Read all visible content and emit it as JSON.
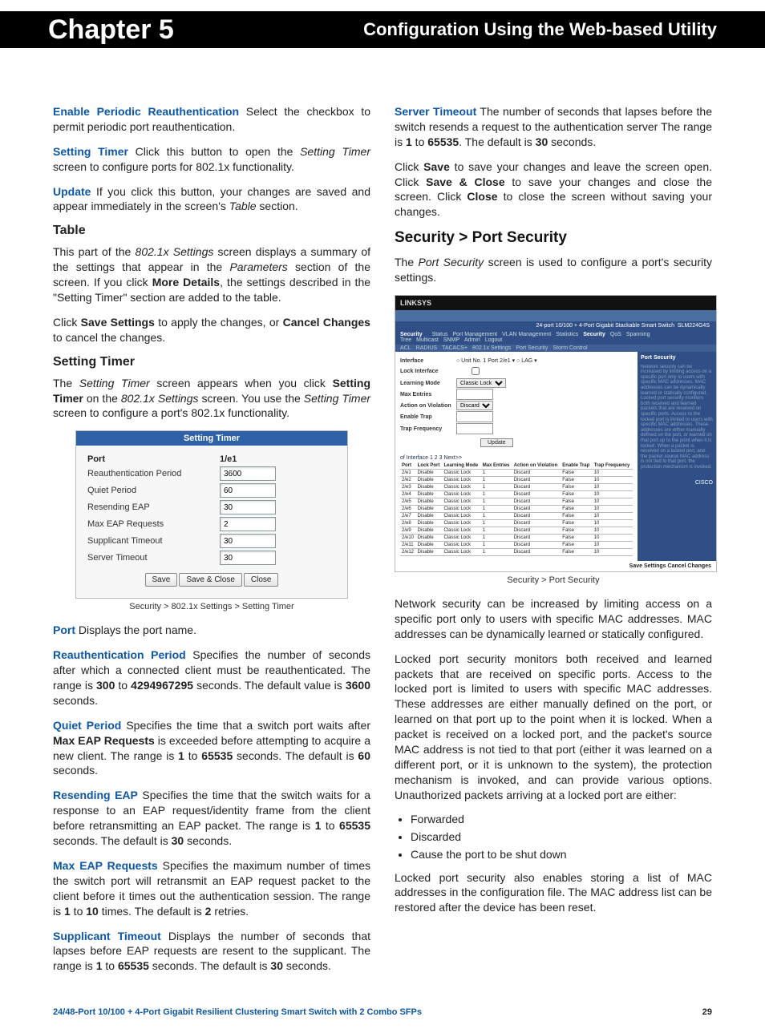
{
  "banner": {
    "chapter": "Chapter 5",
    "title": "Configuration Using the Web-based Utility"
  },
  "left": {
    "p1": {
      "term": "Enable Periodic Reauthentication",
      "text": "  Select the checkbox to permit periodic port reauthentication."
    },
    "p2": {
      "term": "Setting Timer",
      "a": "  Click this button to open the ",
      "i": "Setting Timer",
      "b": " screen to configure ports for 802.1x functionality."
    },
    "p3": {
      "term": "Update",
      "a": "  If you click this button, your changes are saved and appear immediately in the screen's ",
      "i": "Table",
      "b": " section."
    },
    "h_table": "Table",
    "p4": {
      "a": "This part of the ",
      "i1": "802.1x Settings",
      "b": " screen displays a summary of the settings that appear in the ",
      "i2": "Parameters",
      "c": " section of the screen. If you click ",
      "bd": "More Details",
      "d": ", the settings described in the \"Setting Timer\" section are added to the table."
    },
    "p5": {
      "a": "Click ",
      "b1": "Save Settings",
      "b": " to apply the changes, or ",
      "b2": "Cancel Changes",
      "c": " to cancel the changes."
    },
    "h_st": "Setting Timer",
    "p6": {
      "a": "The ",
      "i1": "Setting Timer",
      "b": " screen appears when you click ",
      "b1": "Setting Timer",
      "c": " on the ",
      "i2": "802.1x Settings",
      "d": " screen. You use the ",
      "i3": "Setting Timer",
      "e": " screen to configure a port's 802.1x functionality."
    },
    "fig1": {
      "title": "Setting Timer",
      "col_value": "1/e1",
      "rows": [
        {
          "label": "Port",
          "value": "1/e1",
          "isHeader": true
        },
        {
          "label": "Reauthentication Period",
          "value": "3600"
        },
        {
          "label": "Quiet Period",
          "value": "60"
        },
        {
          "label": "Resending EAP",
          "value": "30"
        },
        {
          "label": "Max EAP Requests",
          "value": "2"
        },
        {
          "label": "Supplicant Timeout",
          "value": "30"
        },
        {
          "label": "Server Timeout",
          "value": "30"
        }
      ],
      "buttons": [
        "Save",
        "Save & Close",
        "Close"
      ],
      "caption": "Security > 802.1x Settings > Setting Timer"
    },
    "p_port": {
      "term": "Port",
      "text": "  Displays the port name."
    },
    "p_rp": {
      "term": "Reauthentication Period",
      "a": " Specifies the number of seconds after which a connected client must be reauthenticated. The range is ",
      "v1": "300",
      "b": " to ",
      "v2": "4294967295",
      "c": " seconds. The default value is ",
      "v3": "3600",
      "d": " seconds."
    },
    "p_qp": {
      "term": "Quiet Period",
      "a": "  Specifies the time that a switch port waits after ",
      "b1": "Max EAP Requests",
      "b": " is exceeded before attempting to acquire a new client. The range is ",
      "v1": "1",
      "c": " to ",
      "v2": "65535",
      "d": " seconds. The default is ",
      "v3": "60",
      "e": " seconds."
    },
    "p_re": {
      "term": "Resending EAP",
      "a": "  Specifies the time that the switch waits for a response to an EAP request/identity frame from the client before retransmitting an EAP packet. The range is ",
      "v1": "1",
      "b": " to ",
      "v2": "65535",
      "c": " seconds. The default is ",
      "v3": "30",
      "d": " seconds."
    },
    "p_me": {
      "term": "Max EAP Requests",
      "a": " Specifies the maximum number of times the switch port will retransmit an EAP request packet to the client before it times out the authentication session. The range is ",
      "v1": "1",
      "b": " to ",
      "v2": "10",
      "c": " times. The default is ",
      "v3": "2",
      "d": " retries."
    },
    "p_su": {
      "term": "Supplicant Timeout",
      "a": "  Displays the number of seconds that lapses before EAP requests are resent to the supplicant. The range is ",
      "v1": "1",
      "b": " to ",
      "v2": "65535",
      "c": " seconds. The default is ",
      "v3": "30",
      "d": " seconds."
    }
  },
  "right": {
    "p_sv": {
      "term": "Server Timeout",
      "a": " The number of seconds that lapses before the switch resends a request to the authentication server The range is ",
      "v1": "1",
      "b": " to ",
      "v2": "65535",
      "c": ". The default is ",
      "v3": "30",
      "d": " seconds."
    },
    "p_save": {
      "a": "Click ",
      "b1": "Save",
      "b": " to save your changes and leave the screen open. Click ",
      "b2": "Save & Close",
      "c": " to save your changes and close the screen. Click ",
      "b3": "Close",
      "d": " to close the screen without saving your changes."
    },
    "h_ps": "Security > Port Security",
    "p_ps1": {
      "a": "The ",
      "i": "Port Security",
      "b": " screen is used to configure a port's security settings."
    },
    "fig2": {
      "brand": "LINKSYS",
      "model": "SLM224G4S",
      "product_line": "24-port 10/100 + 4-Port Gigabit Stackable Smart Switch",
      "section": "Security",
      "tabs": [
        "Status",
        "Port Management",
        "VLAN Management",
        "Statistics",
        "Security",
        "QoS",
        "Spanning Tree",
        "Multicast",
        "SNMP",
        "Admin",
        "Logout"
      ],
      "subtabs": [
        "ACL",
        "RADIUS",
        "TACACS+",
        "802.1x Settings",
        "Port Security",
        "Storm Control"
      ],
      "help_title": "Port Security",
      "form": [
        {
          "label": "Interface",
          "value": "Unit No. 1 Port 2/e1  LAG"
        },
        {
          "label": "Lock Interface",
          "value": "checkbox"
        },
        {
          "label": "Learning Mode",
          "value": "Classic Lock"
        },
        {
          "label": "Max Entries",
          "value": ""
        },
        {
          "label": "Action on Violation",
          "value": "Discard"
        },
        {
          "label": "Enable Trap",
          "value": ""
        },
        {
          "label": "Trap Frequency",
          "value": ""
        }
      ],
      "update": "Update",
      "pagination": "of Interface   1   2   3   Next>>",
      "table_headers": [
        "Port",
        "Lock Port",
        "Learning Mode",
        "Max Entries",
        "Action on Violation",
        "Enable Trap",
        "Trap Frequency"
      ],
      "table_rows": [
        [
          "2/e1",
          "Disable",
          "Classic Lock",
          "1",
          "Discard",
          "False",
          "10"
        ],
        [
          "2/e2",
          "Disable",
          "Classic Lock",
          "1",
          "Discard",
          "False",
          "10"
        ],
        [
          "2/e3",
          "Disable",
          "Classic Lock",
          "1",
          "Discard",
          "False",
          "10"
        ],
        [
          "2/e4",
          "Disable",
          "Classic Lock",
          "1",
          "Discard",
          "False",
          "10"
        ],
        [
          "2/e5",
          "Disable",
          "Classic Lock",
          "1",
          "Discard",
          "False",
          "10"
        ],
        [
          "2/e6",
          "Disable",
          "Classic Lock",
          "1",
          "Discard",
          "False",
          "10"
        ],
        [
          "2/e7",
          "Disable",
          "Classic Lock",
          "1",
          "Discard",
          "False",
          "10"
        ],
        [
          "2/e8",
          "Disable",
          "Classic Lock",
          "1",
          "Discard",
          "False",
          "10"
        ],
        [
          "2/e9",
          "Disable",
          "Classic Lock",
          "1",
          "Discard",
          "False",
          "10"
        ],
        [
          "2/e10",
          "Disable",
          "Classic Lock",
          "1",
          "Discard",
          "False",
          "10"
        ],
        [
          "2/e11",
          "Disable",
          "Classic Lock",
          "1",
          "Discard",
          "False",
          "10"
        ],
        [
          "2/e12",
          "Disable",
          "Classic Lock",
          "1",
          "Discard",
          "False",
          "10"
        ]
      ],
      "save_row": "Save Settings   Cancel Changes",
      "cisco": "CISCO",
      "caption": "Security > Port Security"
    },
    "p_ns": "Network security can be increased by limiting access on a specific port only to users with specific MAC addresses. MAC addresses can be dynamically learned or statically configured.",
    "p_lp": "Locked port security monitors both received and learned packets that are received on specific ports. Access to the locked port is limited to users with specific MAC addresses. These addresses are either manually defined on the port, or learned on that port up to the point when it is locked. When a packet is received on a locked port, and the packet's source MAC address is not tied to that port (either it was learned on a different port, or it is unknown to the system), the protection mechanism is invoked, and can provide various options. Unauthorized packets arriving at a locked port are either:",
    "bullets": [
      "Forwarded",
      "Discarded",
      "Cause the port to be shut down"
    ],
    "p_last": "Locked port security also enables storing a list of MAC addresses in the configuration file. The MAC address list can be restored after the device has been reset."
  },
  "footer": {
    "left": "24/48-Port 10/100 + 4-Port Gigabit Resilient Clustering Smart Switch with 2 Combo SFPs",
    "right": "29"
  }
}
